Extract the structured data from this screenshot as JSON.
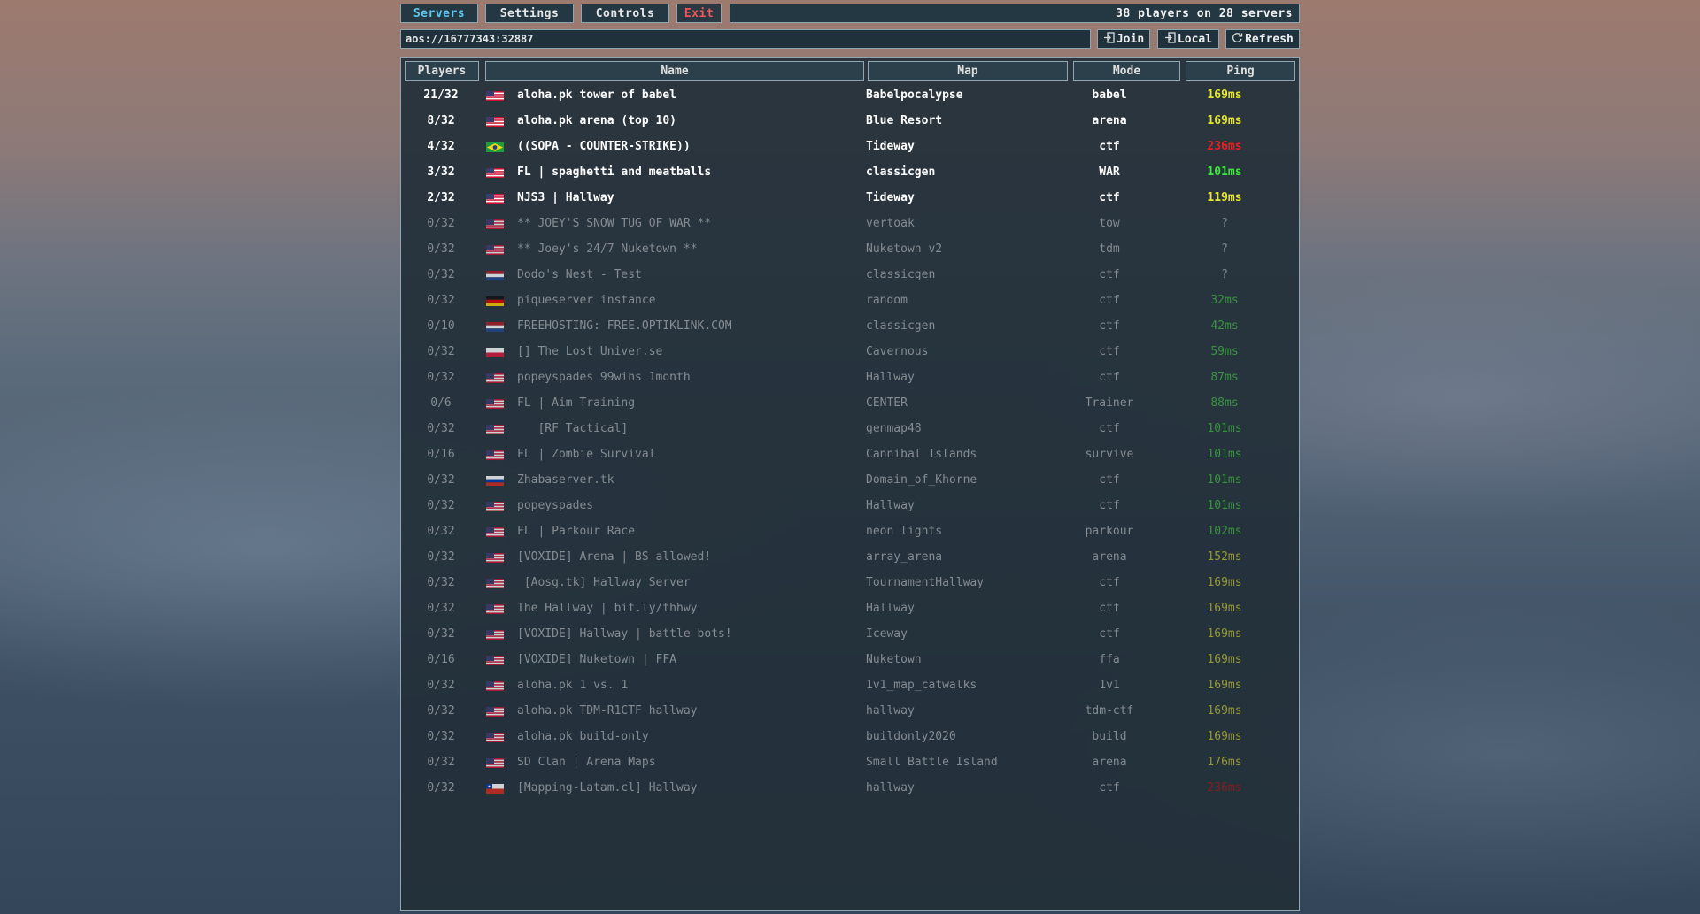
{
  "menu": {
    "servers_label": "Servers",
    "settings_label": "Settings",
    "controls_label": "Controls",
    "exit_label": "Exit",
    "status_text": "38 players on 28 servers"
  },
  "address_bar": {
    "value": "aos://16777343:32887",
    "join_label": "Join",
    "local_label": "Local",
    "refresh_label": "Refresh"
  },
  "table": {
    "columns": [
      "Players",
      "Name",
      "Map",
      "Mode",
      "Ping"
    ],
    "rows": [
      {
        "players": "21/32",
        "flag": "us",
        "name": "aloha.pk tower of babel",
        "map": "Babelpocalypse",
        "mode": "babel",
        "ping": "169ms",
        "ping_color": "#e6e62e",
        "active": true
      },
      {
        "players": "8/32",
        "flag": "us",
        "name": "aloha.pk arena (top 10)",
        "map": "Blue Resort",
        "mode": "arena",
        "ping": "169ms",
        "ping_color": "#e6e62e",
        "active": true
      },
      {
        "players": "4/32",
        "flag": "br",
        "name": "((SOPA - COUNTER-STRIKE))",
        "map": "Tideway",
        "mode": "ctf",
        "ping": "236ms",
        "ping_color": "#e62020",
        "active": true
      },
      {
        "players": "3/32",
        "flag": "us",
        "name": "FL | spaghetti and meatballs",
        "map": "classicgen",
        "mode": "WAR",
        "ping": "101ms",
        "ping_color": "#3ee63e",
        "active": true
      },
      {
        "players": "2/32",
        "flag": "us",
        "name": "NJS3 | Hallway",
        "map": "Tideway",
        "mode": "ctf",
        "ping": "119ms",
        "ping_color": "#e6e62e",
        "active": true
      },
      {
        "players": "0/32",
        "flag": "us",
        "name": "** JOEY'S SNOW TUG OF WAR **",
        "map": "vertoak",
        "mode": "tow",
        "ping": "?",
        "ping_color": "#a0a4a8",
        "active": false
      },
      {
        "players": "0/32",
        "flag": "us",
        "name": "** Joey's 24/7 Nuketown **",
        "map": "Nuketown v2",
        "mode": "tdm",
        "ping": "?",
        "ping_color": "#a0a4a8",
        "active": false
      },
      {
        "players": "0/32",
        "flag": "nl",
        "name": "Dodo's Nest - Test",
        "map": "classicgen",
        "mode": "ctf",
        "ping": "?",
        "ping_color": "#a0a4a8",
        "active": false
      },
      {
        "players": "0/32",
        "flag": "de",
        "name": "piqueserver instance",
        "map": "random",
        "mode": "ctf",
        "ping": "32ms",
        "ping_color": "#3fae3f",
        "active": false
      },
      {
        "players": "0/10",
        "flag": "nl",
        "name": "FREEHOSTING: FREE.OPTIKLINK.COM",
        "map": "classicgen",
        "mode": "ctf",
        "ping": "42ms",
        "ping_color": "#3fae3f",
        "active": false
      },
      {
        "players": "0/32",
        "flag": "pl",
        "name": "[] The Lost Univer.se",
        "map": "Cavernous",
        "mode": "ctf",
        "ping": "59ms",
        "ping_color": "#3fae3f",
        "active": false
      },
      {
        "players": "0/32",
        "flag": "us",
        "name": "popeyspades 99wins 1month",
        "map": "Hallway",
        "mode": "ctf",
        "ping": "87ms",
        "ping_color": "#3fae3f",
        "active": false
      },
      {
        "players": "0/6",
        "flag": "us",
        "name": "FL | Aim Training",
        "map": "CENTER",
        "mode": "Trainer",
        "ping": "88ms",
        "ping_color": "#3fae3f",
        "active": false
      },
      {
        "players": "0/32",
        "flag": "us",
        "name": "   [RF Tactical]",
        "map": "genmap48",
        "mode": "ctf",
        "ping": "101ms",
        "ping_color": "#3fae3f",
        "active": false
      },
      {
        "players": "0/16",
        "flag": "us",
        "name": "FL | Zombie Survival",
        "map": "Cannibal Islands",
        "mode": "survive",
        "ping": "101ms",
        "ping_color": "#3fae3f",
        "active": false
      },
      {
        "players": "0/32",
        "flag": "ru",
        "name": "Zhabaserver.tk",
        "map": "Domain_of_Khorne",
        "mode": "ctf",
        "ping": "101ms",
        "ping_color": "#3fae3f",
        "active": false
      },
      {
        "players": "0/32",
        "flag": "us",
        "name": "popeyspades",
        "map": "Hallway",
        "mode": "ctf",
        "ping": "101ms",
        "ping_color": "#3fae3f",
        "active": false
      },
      {
        "players": "0/32",
        "flag": "us",
        "name": "FL | Parkour Race",
        "map": "neon lights",
        "mode": "parkour",
        "ping": "102ms",
        "ping_color": "#3fae3f",
        "active": false
      },
      {
        "players": "0/32",
        "flag": "us",
        "name": "[VOXIDE] Arena | BS allowed!",
        "map": "array_arena",
        "mode": "arena",
        "ping": "152ms",
        "ping_color": "#b5b532",
        "active": false
      },
      {
        "players": "0/32",
        "flag": "us",
        "name": " [Aosg.tk] Hallway Server",
        "map": "TournamentHallway",
        "mode": "ctf",
        "ping": "169ms",
        "ping_color": "#b5b532",
        "active": false
      },
      {
        "players": "0/32",
        "flag": "us",
        "name": "The Hallway | bit.ly/thhwy",
        "map": "Hallway",
        "mode": "ctf",
        "ping": "169ms",
        "ping_color": "#b5b532",
        "active": false
      },
      {
        "players": "0/32",
        "flag": "us",
        "name": "[VOXIDE] Hallway | battle bots!",
        "map": "Iceway",
        "mode": "ctf",
        "ping": "169ms",
        "ping_color": "#b5b532",
        "active": false
      },
      {
        "players": "0/16",
        "flag": "us",
        "name": "[VOXIDE] Nuketown | FFA",
        "map": "Nuketown",
        "mode": "ffa",
        "ping": "169ms",
        "ping_color": "#b5b532",
        "active": false
      },
      {
        "players": "0/32",
        "flag": "us",
        "name": "aloha.pk 1 vs. 1",
        "map": "1v1_map_catwalks",
        "mode": "1v1",
        "ping": "169ms",
        "ping_color": "#b5b532",
        "active": false
      },
      {
        "players": "0/32",
        "flag": "us",
        "name": "aloha.pk TDM-R1CTF hallway",
        "map": "hallway",
        "mode": "tdm-ctf",
        "ping": "169ms",
        "ping_color": "#b5b532",
        "active": false
      },
      {
        "players": "0/32",
        "flag": "us",
        "name": "aloha.pk build-only",
        "map": "buildonly2020",
        "mode": "build",
        "ping": "169ms",
        "ping_color": "#b5b532",
        "active": false
      },
      {
        "players": "0/32",
        "flag": "us",
        "name": "SD Clan | Arena Maps",
        "map": "Small Battle Island",
        "mode": "arena",
        "ping": "176ms",
        "ping_color": "#b5b532",
        "active": false
      },
      {
        "players": "0/32",
        "flag": "cl",
        "name": "[Mapping-Latam.cl] Hallway",
        "map": "hallway",
        "mode": "ctf",
        "ping": "236ms",
        "ping_color": "#a01818",
        "active": false
      }
    ]
  }
}
